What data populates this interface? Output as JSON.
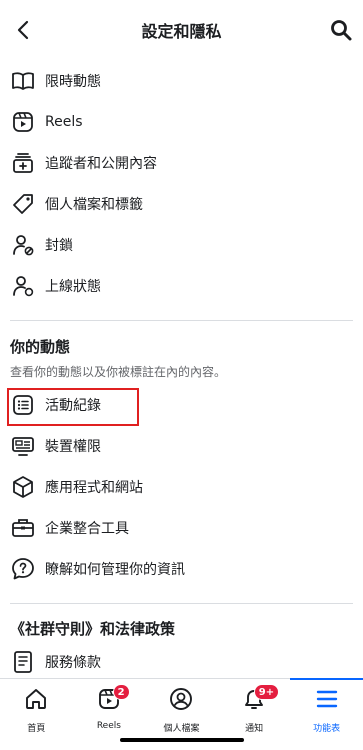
{
  "header": {
    "title": "設定和隱私"
  },
  "section1": {
    "items": [
      {
        "label": "限時動態",
        "icon": "book-icon"
      },
      {
        "label": "Reels",
        "icon": "reels-icon"
      },
      {
        "label": "追蹤者和公開內容",
        "icon": "followers-icon"
      },
      {
        "label": "個人檔案和標籤",
        "icon": "tag-icon"
      },
      {
        "label": "封鎖",
        "icon": "block-user-icon"
      },
      {
        "label": "上線狀態",
        "icon": "active-status-icon"
      }
    ]
  },
  "section2": {
    "title": "你的動態",
    "subtitle": "查看你的動態以及你被標註在內的內容。",
    "items": [
      {
        "label": "活動紀錄",
        "icon": "activity-log-icon"
      },
      {
        "label": "裝置權限",
        "icon": "device-permissions-icon"
      },
      {
        "label": "應用程式和網站",
        "icon": "apps-websites-icon"
      },
      {
        "label": "企業整合工具",
        "icon": "briefcase-icon"
      },
      {
        "label": "瞭解如何管理你的資訊",
        "icon": "info-help-icon"
      }
    ]
  },
  "section3": {
    "title": "《社群守則》和法律政策",
    "items": [
      {
        "label": "服務條款",
        "icon": "document-icon"
      }
    ]
  },
  "tabbar": {
    "tabs": [
      {
        "label": "首頁",
        "icon": "home-icon",
        "badge": ""
      },
      {
        "label": "Reels",
        "icon": "reels-tab-icon",
        "badge": "2"
      },
      {
        "label": "個人檔案",
        "icon": "profile-icon",
        "badge": ""
      },
      {
        "label": "通知",
        "icon": "bell-icon",
        "badge": "9+"
      },
      {
        "label": "功能表",
        "icon": "menu-icon",
        "badge": "",
        "active": true
      }
    ]
  },
  "colors": {
    "accent": "#0866ff",
    "badge": "#e41e3f",
    "highlight": "#e02020"
  }
}
